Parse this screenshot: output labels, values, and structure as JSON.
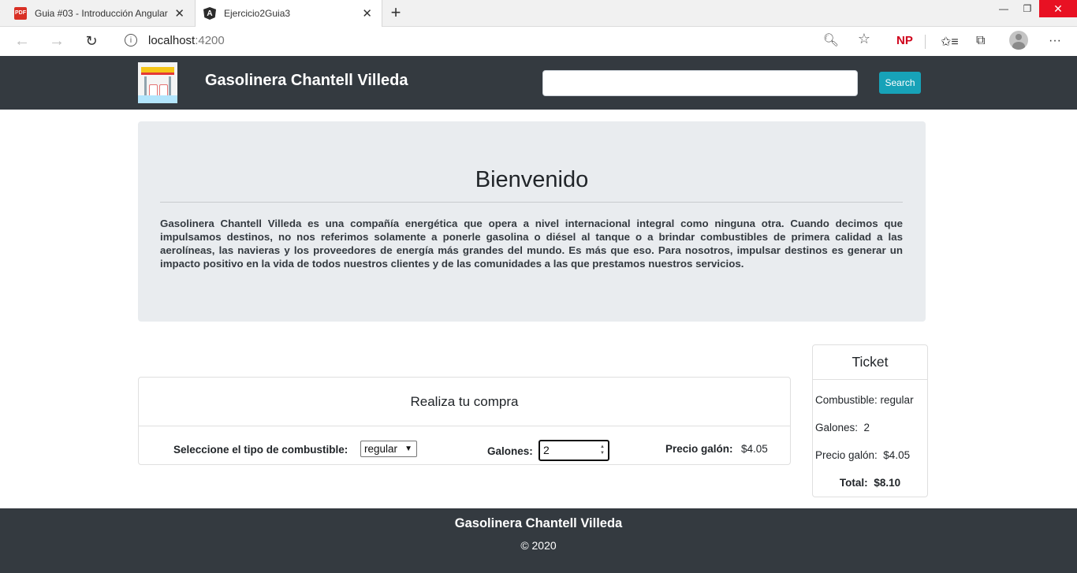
{
  "browser": {
    "tabs": [
      {
        "title": "Guia #03 - Introducción Angular",
        "favicon": "pdf-icon",
        "active": false
      },
      {
        "title": "Ejercicio2Guia3",
        "favicon": "angular-icon",
        "active": true
      }
    ],
    "url_host": "localhost",
    "url_port": ":4200",
    "profile_badge": "NP"
  },
  "navbar": {
    "brand": "Gasolinera Chantell Villeda",
    "search_placeholder": "",
    "search_button": "Search",
    "bg_color": "#343a40",
    "button_color": "#17a2b8"
  },
  "jumbotron": {
    "title": "Bienvenido",
    "body": "Gasolinera Chantell Villeda es una compañía energética que opera a nivel internacional integral como ninguna otra. Cuando decimos que impulsamos destinos, no nos referimos solamente a ponerle gasolina o diésel al tanque o a brindar combustibles de primera calidad a las aerolíneas, las navieras y los proveedores de energía más grandes del mundo. Es más que eso. Para nosotros, impulsar destinos es generar un impacto positivo en la vida de todos nuestros clientes y de las comunidades a las que prestamos nuestros servicios."
  },
  "purchase": {
    "header": "Realiza tu compra",
    "fuel_label": "Seleccione el tipo de combustible:",
    "fuel_selected": "regular",
    "gallons_label": "Galones:",
    "gallons_value": "2",
    "price_label": "Precio galón:",
    "price_value": "$4.05"
  },
  "ticket": {
    "header": "Ticket",
    "fuel": "Combustible: regular",
    "gallons": "Galones:  2",
    "price": "Precio galón:  $4.05",
    "total_label": "Total:",
    "total_value": "$8.10"
  },
  "footer": {
    "title": "Gasolinera Chantell Villeda",
    "copyright": "© 2020"
  }
}
